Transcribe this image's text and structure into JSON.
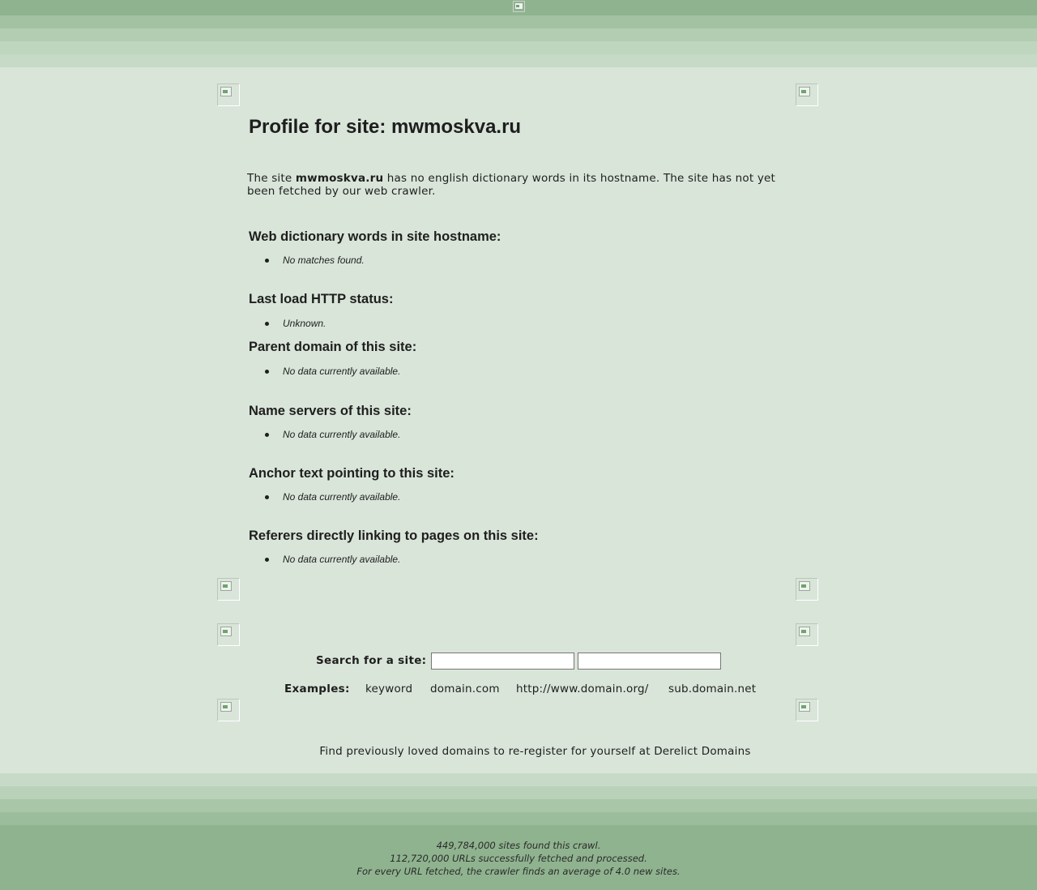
{
  "page": {
    "title": "Profile for site: mwmoskva.ru",
    "site": "mwmoskva.ru"
  },
  "intro": {
    "prefix": "The site ",
    "site": "mwmoskva.ru",
    "suffix": " has no english dictionary words in its hostname. The site has not yet been fetched by our web crawler."
  },
  "sections": [
    {
      "heading": "Web dictionary words in site hostname:",
      "item": "No matches found."
    },
    {
      "heading": "Last load HTTP status:",
      "item": "Unknown."
    },
    {
      "heading": "Parent domain of this site:",
      "item": "No data currently available."
    },
    {
      "heading": "Name servers of this site:",
      "item": "No data currently available."
    },
    {
      "heading": "Anchor text pointing to this site:",
      "item": "No data currently available."
    },
    {
      "heading": "Referers directly linking to pages on this site:",
      "item": "No data currently available."
    }
  ],
  "search": {
    "label": "Search for a site:",
    "input1_value": "",
    "input2_value": "",
    "examples_label": "Examples:",
    "examples": [
      "keyword",
      "domain.com",
      "http://www.domain.org/",
      "sub.domain.net"
    ]
  },
  "promo": {
    "prefix": "Find previously loved domains to re-register for yourself at ",
    "link": "Derelict Domains"
  },
  "footer": {
    "sites_found": "449,784,000 sites found this crawl.",
    "urls_fetched": "112,720,000 URLs successfully fetched and processed.",
    "average": "For every URL fetched, the crawler finds an average of 4.0 new sites."
  },
  "colors": {
    "background": "#d9e5d9",
    "band_dark": "#8fb38f",
    "text": "#1e1e1e"
  }
}
